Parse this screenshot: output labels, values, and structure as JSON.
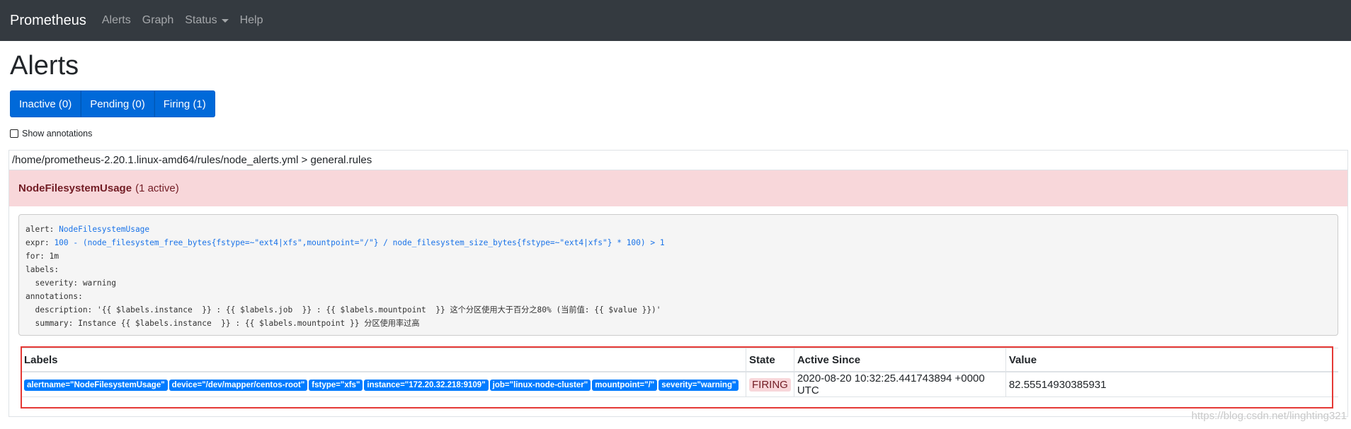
{
  "navbar": {
    "brand": "Prometheus",
    "links": [
      "Alerts",
      "Graph",
      "Status",
      "Help"
    ]
  },
  "page": {
    "title": "Alerts"
  },
  "filters": {
    "inactive": "Inactive (0)",
    "pending": "Pending (0)",
    "firing": "Firing (1)"
  },
  "annotations_toggle": {
    "label": "Show annotations",
    "checked": false
  },
  "rule_group": {
    "path": "/home/prometheus-2.20.1.linux-amd64/rules/node_alerts.yml > general.rules",
    "alert_name": "NodeFilesystemUsage",
    "active_count": "(1 active)",
    "definition": {
      "alert_key": "alert:",
      "alert_value": "NodeFilesystemUsage",
      "expr_key": "expr:",
      "expr_value": "100 - (node_filesystem_free_bytes{fstype=~\"ext4|xfs\",mountpoint=\"/\"} / node_filesystem_size_bytes{fstype=~\"ext4|xfs\"} * 100) > 1",
      "for_line": "for: 1m",
      "labels_line": "labels:",
      "severity_line": "  severity: warning",
      "annotations_line": "annotations:",
      "description_line": "  description: '{{ $labels.instance  }} : {{ $labels.job  }} : {{ $labels.mountpoint  }} 这个分区使用大于百分之80% (当前值: {{ $value }})'",
      "summary_line": "  summary: Instance {{ $labels.instance  }} : {{ $labels.mountpoint }} 分区使用率过高"
    }
  },
  "active_alerts": {
    "headers": {
      "labels": "Labels",
      "state": "State",
      "active_since": "Active Since",
      "value": "Value"
    },
    "rows": [
      {
        "labels": [
          "alertname=\"NodeFilesystemUsage\"",
          "device=\"/dev/mapper/centos-root\"",
          "fstype=\"xfs\"",
          "instance=\"172.20.32.218:9109\"",
          "job=\"linux-node-cluster\"",
          "mountpoint=\"/\"",
          "severity=\"warning\""
        ],
        "state": "FIRING",
        "active_since": "2020-08-20 10:32:25.441743894 +0000 UTC",
        "value": "82.55514930385931"
      }
    ]
  },
  "watermark": "https://blog.csdn.net/linghting321",
  "colors": {
    "navbar_bg": "#343a40",
    "button_blue": "#0069d9",
    "label_blue": "#007bff",
    "firing_bg": "#f8d7da",
    "firing_text": "#721c24",
    "highlight_red": "#e53935"
  }
}
